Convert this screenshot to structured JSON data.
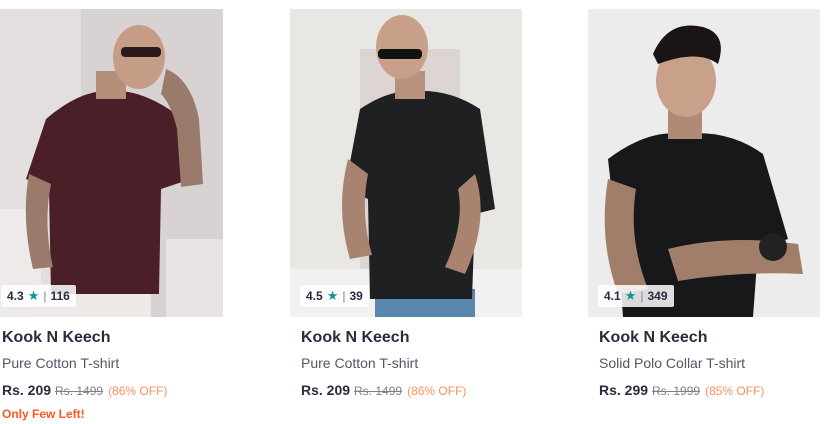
{
  "products": [
    {
      "rating": "4.3",
      "rating_count": "116",
      "brand": "Kook N Keech",
      "name": "Pure Cotton T-shirt",
      "price": "Rs. 209",
      "mrp": "Rs. 1499",
      "discount": "(86% OFF)",
      "stock_note": "Only Few Left!",
      "shirt_color": "#4a1f28"
    },
    {
      "rating": "4.5",
      "rating_count": "39",
      "brand": "Kook N Keech",
      "name": "Pure Cotton T-shirt",
      "price": "Rs. 209",
      "mrp": "Rs. 1499",
      "discount": "(86% OFF)",
      "shirt_color": "#1f2022"
    },
    {
      "rating": "4.1",
      "rating_count": "349",
      "brand": "Kook N Keech",
      "name": "Solid Polo Collar T-shirt",
      "price": "Rs. 299",
      "mrp": "Rs. 1999",
      "discount": "(85% OFF)",
      "shirt_color": "#17181a"
    }
  ],
  "colors": {
    "star": "#14958f",
    "discount": "#ff905a",
    "stock": "#ff5722"
  },
  "icons": {
    "rating": "star-icon"
  }
}
